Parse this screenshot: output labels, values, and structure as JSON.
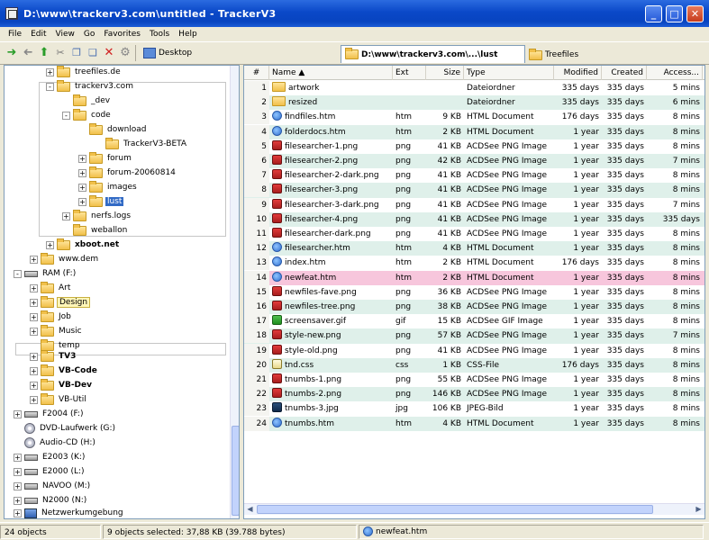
{
  "window": {
    "title": "D:\\www\\trackerv3.com\\untitled - TrackerV3",
    "minimize": "_",
    "maximize": "□",
    "close": "✕"
  },
  "menu": [
    "File",
    "Edit",
    "View",
    "Go",
    "Favorites",
    "Tools",
    "Help"
  ],
  "toolbar": {
    "desktop_label": "Desktop"
  },
  "tabs": {
    "active_path": "D:\\www\\trackerv3.com\\...\\lust",
    "tree_files": "Treefiles"
  },
  "tree": [
    {
      "label": "treefiles.de",
      "expander": "+",
      "selected": false
    },
    {
      "label": "trackerv3.com",
      "expander": "-",
      "selected": false
    },
    {
      "label": "_dev",
      "expander": "",
      "selected": false
    },
    {
      "label": "code",
      "expander": "-",
      "selected": false
    },
    {
      "label": "download",
      "expander": "",
      "selected": false
    },
    {
      "label": "TrackerV3-BETA",
      "expander": "",
      "selected": false
    },
    {
      "label": "forum",
      "expander": "+",
      "selected": false
    },
    {
      "label": "forum-20060814",
      "expander": "+",
      "selected": false
    },
    {
      "label": "images",
      "expander": "+",
      "selected": false
    },
    {
      "label": "lust",
      "expander": "+",
      "selected": true
    },
    {
      "label": "nerfs.logs",
      "expander": "+",
      "selected": false
    },
    {
      "label": "weballon",
      "expander": "",
      "selected": false
    },
    {
      "label": "xboot.net",
      "expander": "+",
      "selected": false
    },
    {
      "label": "www.dem",
      "expander": "+",
      "selected": false
    },
    {
      "label": "RAM (F:)",
      "expander": "-",
      "selected": false
    },
    {
      "label": "Art",
      "expander": "+",
      "selected": false
    },
    {
      "label": "Design",
      "expander": "+",
      "selected": false
    },
    {
      "label": "Job",
      "expander": "+",
      "selected": false
    },
    {
      "label": "Music",
      "expander": "+",
      "selected": false
    },
    {
      "label": "temp",
      "expander": "",
      "selected": false
    },
    {
      "label": "TV3",
      "expander": "+",
      "selected": false
    },
    {
      "label": "VB-Code",
      "expander": "+",
      "selected": false
    },
    {
      "label": "VB-Dev",
      "expander": "+",
      "selected": false
    },
    {
      "label": "VB-Util",
      "expander": "+",
      "selected": false
    },
    {
      "label": "F2004 (F:)",
      "expander": "+",
      "selected": false
    },
    {
      "label": "DVD-Laufwerk (G:)",
      "expander": "",
      "selected": false
    },
    {
      "label": "Audio-CD (H:)",
      "expander": "",
      "selected": false
    },
    {
      "label": "E2003 (K:)",
      "expander": "+",
      "selected": false
    },
    {
      "label": "E2000 (L:)",
      "expander": "+",
      "selected": false
    },
    {
      "label": "NAVOO (M:)",
      "expander": "+",
      "selected": false
    },
    {
      "label": "N2000 (N:)",
      "expander": "+",
      "selected": false
    },
    {
      "label": "Netzwerkumgebung",
      "expander": "+",
      "selected": false
    }
  ],
  "grid": {
    "columns": [
      "#",
      "Name  ▲",
      "Ext",
      "Size",
      "Type",
      "Modified",
      "Created",
      "Access..."
    ],
    "rows": [
      {
        "n": "1",
        "name": "artwork",
        "ext": "",
        "size": "",
        "type": "Dateiordner",
        "mod": "335 days",
        "cre": "335 days",
        "acc": "5 mins",
        "icon": "folder",
        "bg": "white"
      },
      {
        "n": "2",
        "name": "resized",
        "ext": "",
        "size": "",
        "type": "Dateiordner",
        "mod": "335 days",
        "cre": "335 days",
        "acc": "6 mins",
        "icon": "folder",
        "bg": "teal"
      },
      {
        "n": "3",
        "name": "findfiles.htm",
        "ext": "htm",
        "size": "9 KB",
        "type": "HTML Document",
        "mod": "176 days",
        "cre": "335 days",
        "acc": "8 mins",
        "icon": "htm",
        "bg": "white"
      },
      {
        "n": "4",
        "name": "folderdocs.htm",
        "ext": "htm",
        "size": "2 KB",
        "type": "HTML Document",
        "mod": "1 year",
        "cre": "335 days",
        "acc": "8 mins",
        "icon": "htm",
        "bg": "teal"
      },
      {
        "n": "5",
        "name": "filesearcher-1.png",
        "ext": "png",
        "size": "41 KB",
        "type": "ACDSee PNG Image",
        "mod": "1 year",
        "cre": "335 days",
        "acc": "8 mins",
        "icon": "png",
        "bg": "white"
      },
      {
        "n": "6",
        "name": "filesearcher-2.png",
        "ext": "png",
        "size": "42 KB",
        "type": "ACDSee PNG Image",
        "mod": "1 year",
        "cre": "335 days",
        "acc": "7 mins",
        "icon": "png",
        "bg": "teal"
      },
      {
        "n": "7",
        "name": "filesearcher-2-dark.png",
        "ext": "png",
        "size": "41 KB",
        "type": "ACDSee PNG Image",
        "mod": "1 year",
        "cre": "335 days",
        "acc": "8 mins",
        "icon": "png",
        "bg": "white"
      },
      {
        "n": "8",
        "name": "filesearcher-3.png",
        "ext": "png",
        "size": "41 KB",
        "type": "ACDSee PNG Image",
        "mod": "1 year",
        "cre": "335 days",
        "acc": "8 mins",
        "icon": "png",
        "bg": "teal"
      },
      {
        "n": "9",
        "name": "filesearcher-3-dark.png",
        "ext": "png",
        "size": "41 KB",
        "type": "ACDSee PNG Image",
        "mod": "1 year",
        "cre": "335 days",
        "acc": "7 mins",
        "icon": "png",
        "bg": "white"
      },
      {
        "n": "10",
        "name": "filesearcher-4.png",
        "ext": "png",
        "size": "41 KB",
        "type": "ACDSee PNG Image",
        "mod": "1 year",
        "cre": "335 days",
        "acc": "335 days",
        "icon": "png",
        "bg": "teal"
      },
      {
        "n": "11",
        "name": "filesearcher-dark.png",
        "ext": "png",
        "size": "41 KB",
        "type": "ACDSee PNG Image",
        "mod": "1 year",
        "cre": "335 days",
        "acc": "8 mins",
        "icon": "png",
        "bg": "white"
      },
      {
        "n": "12",
        "name": "filesearcher.htm",
        "ext": "htm",
        "size": "4 KB",
        "type": "HTML Document",
        "mod": "1 year",
        "cre": "335 days",
        "acc": "8 mins",
        "icon": "htm",
        "bg": "teal"
      },
      {
        "n": "13",
        "name": "index.htm",
        "ext": "htm",
        "size": "2 KB",
        "type": "HTML Document",
        "mod": "176 days",
        "cre": "335 days",
        "acc": "8 mins",
        "icon": "htm",
        "bg": "white"
      },
      {
        "n": "14",
        "name": "newfeat.htm",
        "ext": "htm",
        "size": "2 KB",
        "type": "HTML Document",
        "mod": "1 year",
        "cre": "335 days",
        "acc": "8 mins",
        "icon": "htm",
        "bg": "pink"
      },
      {
        "n": "15",
        "name": "newfiles-fave.png",
        "ext": "png",
        "size": "36 KB",
        "type": "ACDSee PNG Image",
        "mod": "1 year",
        "cre": "335 days",
        "acc": "8 mins",
        "icon": "png",
        "bg": "white"
      },
      {
        "n": "16",
        "name": "newfiles-tree.png",
        "ext": "png",
        "size": "38 KB",
        "type": "ACDSee PNG Image",
        "mod": "1 year",
        "cre": "335 days",
        "acc": "8 mins",
        "icon": "png",
        "bg": "teal"
      },
      {
        "n": "17",
        "name": "screensaver.gif",
        "ext": "gif",
        "size": "15 KB",
        "type": "ACDSee GIF Image",
        "mod": "1 year",
        "cre": "335 days",
        "acc": "8 mins",
        "icon": "gif",
        "bg": "white"
      },
      {
        "n": "18",
        "name": "style-new.png",
        "ext": "png",
        "size": "57 KB",
        "type": "ACDSee PNG Image",
        "mod": "1 year",
        "cre": "335 days",
        "acc": "7 mins",
        "icon": "png",
        "bg": "teal"
      },
      {
        "n": "19",
        "name": "style-old.png",
        "ext": "png",
        "size": "41 KB",
        "type": "ACDSee PNG Image",
        "mod": "1 year",
        "cre": "335 days",
        "acc": "8 mins",
        "icon": "png",
        "bg": "white"
      },
      {
        "n": "20",
        "name": "tnd.css",
        "ext": "css",
        "size": "1 KB",
        "type": "CSS-File",
        "mod": "176 days",
        "cre": "335 days",
        "acc": "8 mins",
        "icon": "css",
        "bg": "teal"
      },
      {
        "n": "21",
        "name": "tnumbs-1.png",
        "ext": "png",
        "size": "55 KB",
        "type": "ACDSee PNG Image",
        "mod": "1 year",
        "cre": "335 days",
        "acc": "8 mins",
        "icon": "png",
        "bg": "white"
      },
      {
        "n": "22",
        "name": "tnumbs-2.png",
        "ext": "png",
        "size": "146 KB",
        "type": "ACDSee PNG Image",
        "mod": "1 year",
        "cre": "335 days",
        "acc": "8 mins",
        "icon": "png",
        "bg": "teal"
      },
      {
        "n": "23",
        "name": "tnumbs-3.jpg",
        "ext": "jpg",
        "size": "106 KB",
        "type": "JPEG-Bild",
        "mod": "1 year",
        "cre": "335 days",
        "acc": "8 mins",
        "icon": "jpg",
        "bg": "white"
      },
      {
        "n": "24",
        "name": "tnumbs.htm",
        "ext": "htm",
        "size": "4 KB",
        "type": "HTML Document",
        "mod": "1 year",
        "cre": "335 days",
        "acc": "8 mins",
        "icon": "htm",
        "bg": "teal"
      }
    ]
  },
  "status": {
    "count": "24 objects",
    "selection": "9 objects selected: 37,88 KB (39.788 bytes)",
    "file": "newfeat.htm"
  },
  "colors": {
    "row_teal": "#dff0ea",
    "row_pink": "#f7c6dc",
    "selection": "#316ac5",
    "title_bar": "#0a48c8"
  }
}
